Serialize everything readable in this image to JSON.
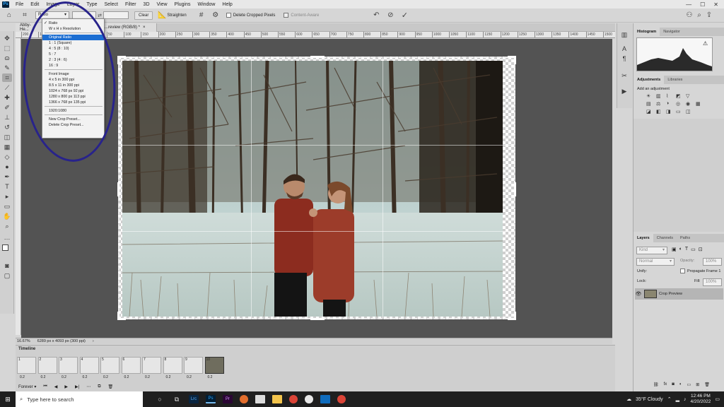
{
  "menu": [
    "File",
    "Edit",
    "Image",
    "Layer",
    "Type",
    "Select",
    "Filter",
    "3D",
    "View",
    "Plugins",
    "Window",
    "Help"
  ],
  "options_bar": {
    "ratio_select": "Ratio",
    "clear_label": "Clear",
    "straighten_label": "Straighten",
    "delete_cropped_label": "Delete Cropped Pixels",
    "content_aware_label": "Content-Aware"
  },
  "doc_tabs": [
    "Abby-He...",
    "...review (RGB/8) *"
  ],
  "ruler_ticks": [
    "200",
    "150",
    "100",
    "50",
    "0",
    "50",
    "100",
    "150",
    "200",
    "250",
    "300",
    "350",
    "400",
    "450",
    "500",
    "550",
    "600",
    "650",
    "700",
    "750",
    "800",
    "850",
    "900",
    "950",
    "1000",
    "1050",
    "1100",
    "1150",
    "1200",
    "1250",
    "1300",
    "1350",
    "1400",
    "1450",
    "1500"
  ],
  "dropdown": {
    "items": [
      {
        "label": "Ratio",
        "checked": true
      },
      {
        "label": "W x H x Resolution"
      },
      {
        "sep": true
      },
      {
        "label": "Original Ratio",
        "selected": true
      },
      {
        "label": "1 : 1 (Square)"
      },
      {
        "label": "4 : 5 (8 : 10)"
      },
      {
        "label": "5 : 7"
      },
      {
        "label": "2 : 3 (4 : 6)"
      },
      {
        "label": "16 : 9"
      },
      {
        "sep": true
      },
      {
        "label": "Front Image"
      },
      {
        "label": "4 x 5 in 300 ppi"
      },
      {
        "label": "8.5 x 11 in 300 ppi"
      },
      {
        "label": "1024 x 768 px 92 ppi"
      },
      {
        "label": "1280 x 800 px 113 ppi"
      },
      {
        "label": "1366 x 768 px 135 ppi"
      },
      {
        "sep": true
      },
      {
        "label": "1920:1080"
      },
      {
        "sep": true
      },
      {
        "label": "New Crop Preset..."
      },
      {
        "label": "Delete Crop Preset..."
      }
    ]
  },
  "status": {
    "zoom": "16.67%",
    "doc_info": "6289 px x 4093 px (300 ppi)"
  },
  "timeline": {
    "title": "Timeline",
    "frames": [
      {
        "num": "1",
        "delay": "0.2"
      },
      {
        "num": "2",
        "delay": "0.2"
      },
      {
        "num": "3",
        "delay": "0.2"
      },
      {
        "num": "4",
        "delay": "0.2"
      },
      {
        "num": "5",
        "delay": "0.2"
      },
      {
        "num": "6",
        "delay": "0.2"
      },
      {
        "num": "7",
        "delay": "0.2"
      },
      {
        "num": "8",
        "delay": "0.2"
      },
      {
        "num": "9",
        "delay": "0.2"
      },
      {
        "num": "10",
        "delay": "0.2"
      }
    ],
    "loop": "Forever"
  },
  "panels": {
    "histogram_tabs": [
      "Histogram",
      "Navigator"
    ],
    "adjust_tabs": [
      "Adjustments",
      "Libraries"
    ],
    "add_adjustment": "Add an adjustment",
    "layer_tabs": [
      "Layers",
      "Channels",
      "Paths"
    ],
    "kind": "Kind",
    "blend_mode": "Normal",
    "opacity_label": "Opacity:",
    "opacity_value": "100%",
    "unify_label": "Unify:",
    "propagate_label": "Propagate Frame 1",
    "lock_label": "Lock:",
    "fill_label": "Fill:",
    "fill_value": "100%",
    "layer_name": "Crop Preview"
  },
  "taskbar": {
    "search_placeholder": "Type here to search",
    "weather": "35°F  Cloudy",
    "time": "12:46 PM",
    "date": "4/20/2022"
  },
  "colors": {
    "accent": "#1c6ed2",
    "annotation": "#28238b"
  }
}
